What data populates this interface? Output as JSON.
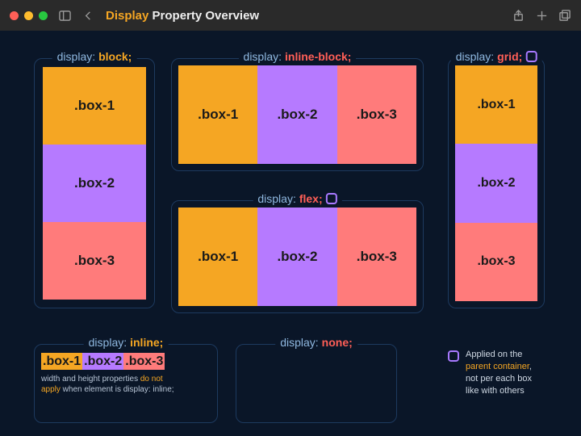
{
  "window": {
    "title_highlight": "Display",
    "title_rest": " Property Overview"
  },
  "panels": {
    "block": {
      "key": "display: ",
      "value": "block;"
    },
    "ib": {
      "key": "display: ",
      "value": "inline-block;"
    },
    "grid": {
      "key": "display: ",
      "value": "grid;"
    },
    "flex": {
      "key": "display: ",
      "value": "flex;"
    },
    "inline": {
      "key": "display: ",
      "value": "inline;"
    },
    "none": {
      "key": "display: ",
      "value": "none;"
    }
  },
  "boxes": {
    "b1": ".box-1",
    "b2": ".box-2",
    "b3": ".box-3"
  },
  "inline_note": {
    "p1a": "width and height properties ",
    "p1b": "do not",
    "p2a": "apply",
    "p2b": " when element is display: inline;"
  },
  "legend": {
    "l1": "Applied on the",
    "l2": "parent container",
    "l3": ",",
    "l4": "not per each box",
    "l5": "like with others"
  }
}
